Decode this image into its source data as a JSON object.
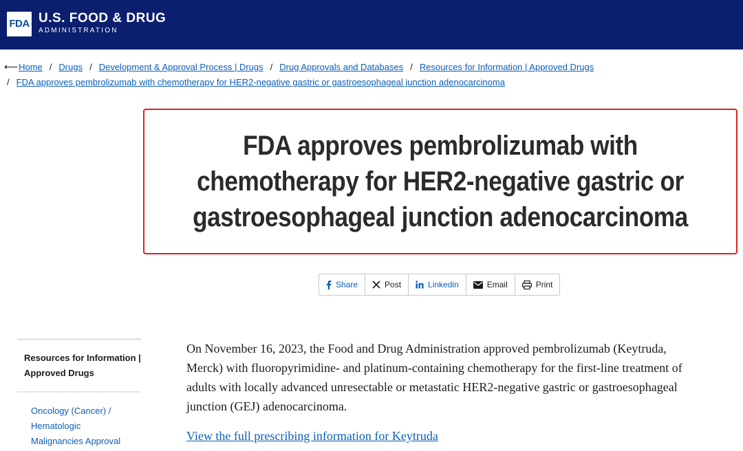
{
  "header": {
    "logo_text": "FDA",
    "agency_name": "U.S. FOOD & DRUG",
    "agency_sub": "ADMINISTRATION",
    "background_color": "#0b1f6e"
  },
  "breadcrumb": {
    "items": [
      {
        "label": "Home"
      },
      {
        "label": "Drugs"
      },
      {
        "label": "Development & Approval Process | Drugs"
      },
      {
        "label": "Drug Approvals and Databases"
      },
      {
        "label": "Resources for Information | Approved Drugs"
      },
      {
        "label": "FDA approves pembrolizumab with chemotherapy for HER2-negative gastric or gastroesophageal junction adenocarcinoma"
      }
    ],
    "separator": "/",
    "back_icon": "arrow-left-icon"
  },
  "title": "FDA approves pembrolizumab with chemotherapy for HER2-negative gastric or gastroesophageal junction adenocarcinoma",
  "share": {
    "buttons": [
      {
        "label": "Share",
        "icon": "facebook-icon"
      },
      {
        "label": "Post",
        "icon": "x-icon"
      },
      {
        "label": "Linkedin",
        "icon": "linkedin-icon"
      },
      {
        "label": "Email",
        "icon": "email-icon"
      },
      {
        "label": "Print",
        "icon": "print-icon"
      }
    ]
  },
  "sidebar": {
    "heading": "Resources for Information | Approved Drugs",
    "link": "Oncology (Cancer) / Hematologic Malignancies Approval"
  },
  "body": {
    "paragraph": "On November 16, 2023, the Food and Drug Administration approved pembrolizumab (Keytruda, Merck) with fluoropyrimidine- and platinum-containing chemotherapy for the first-line treatment of adults with locally advanced unresectable or metastatic HER2-negative gastric or gastroesophageal junction (GEJ) adenocarcinoma.",
    "link": "View the full prescribing information for Keytruda"
  },
  "colors": {
    "link": "#0b5eb8",
    "highlight_border": "#e02020"
  }
}
